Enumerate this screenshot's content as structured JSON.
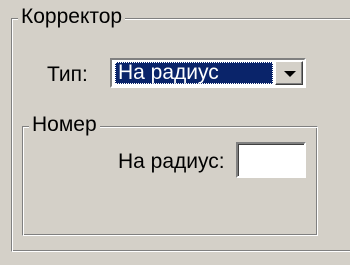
{
  "corrector_group": {
    "title": "Корректор",
    "type_label": "Тип:",
    "type_combo": {
      "selected": "На радиус"
    }
  },
  "number_group": {
    "title": "Номер",
    "radius_label": "На радиус:",
    "radius_value": ""
  },
  "colors": {
    "face": "#d4d0c8",
    "selection": "#0a246a",
    "field": "#ffffff"
  }
}
